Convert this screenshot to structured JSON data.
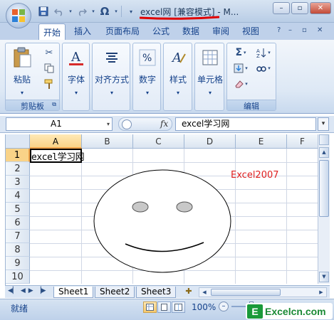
{
  "window": {
    "title": "excel网  [兼容模式] - M...",
    "controls": {
      "minimize": "–",
      "restore": "▫",
      "close": "✕"
    }
  },
  "quick_access": {
    "save_icon": "save-icon",
    "undo_icon": "undo-icon",
    "redo_icon": "redo-icon",
    "omega": "Ω"
  },
  "tabs": {
    "items": [
      "开始",
      "插入",
      "页面布局",
      "公式",
      "数据",
      "审阅",
      "视图"
    ],
    "active": "开始",
    "help": "?",
    "minimize": "–",
    "restore": "▫",
    "close": "✕"
  },
  "ribbon": {
    "clipboard": {
      "label": "剪贴板",
      "paste": "粘贴"
    },
    "font": {
      "label": "字体"
    },
    "align": {
      "label": "对齐方式"
    },
    "number": {
      "label": "数字"
    },
    "style": {
      "label": "样式"
    },
    "cells": {
      "label": "单元格"
    },
    "editing": {
      "label": "编辑"
    }
  },
  "formula_bar": {
    "name_box": "A1",
    "fx": "fx",
    "content": "excel学习网"
  },
  "grid": {
    "columns": [
      "A",
      "B",
      "C",
      "D",
      "E",
      "F"
    ],
    "rows": [
      "1",
      "2",
      "3",
      "4",
      "5",
      "6",
      "7",
      "8",
      "9",
      "10"
    ],
    "selected_column": "A",
    "selected_row": "1",
    "a1_value": "excel学习网",
    "label": "Excel2007"
  },
  "sheets": {
    "tabs": [
      "Sheet1",
      "Sheet2",
      "Sheet3"
    ],
    "active": "Sheet1"
  },
  "status": {
    "ready": "就绪",
    "zoom": "100%",
    "zoom_minus": "–"
  },
  "watermark": {
    "logo": "E",
    "text": "Excelcn.com"
  },
  "colors": {
    "accent": "#15428b",
    "ribbon_bg": "#dde8f5",
    "selected_header": "#f9d388",
    "label_red": "#e02020"
  }
}
